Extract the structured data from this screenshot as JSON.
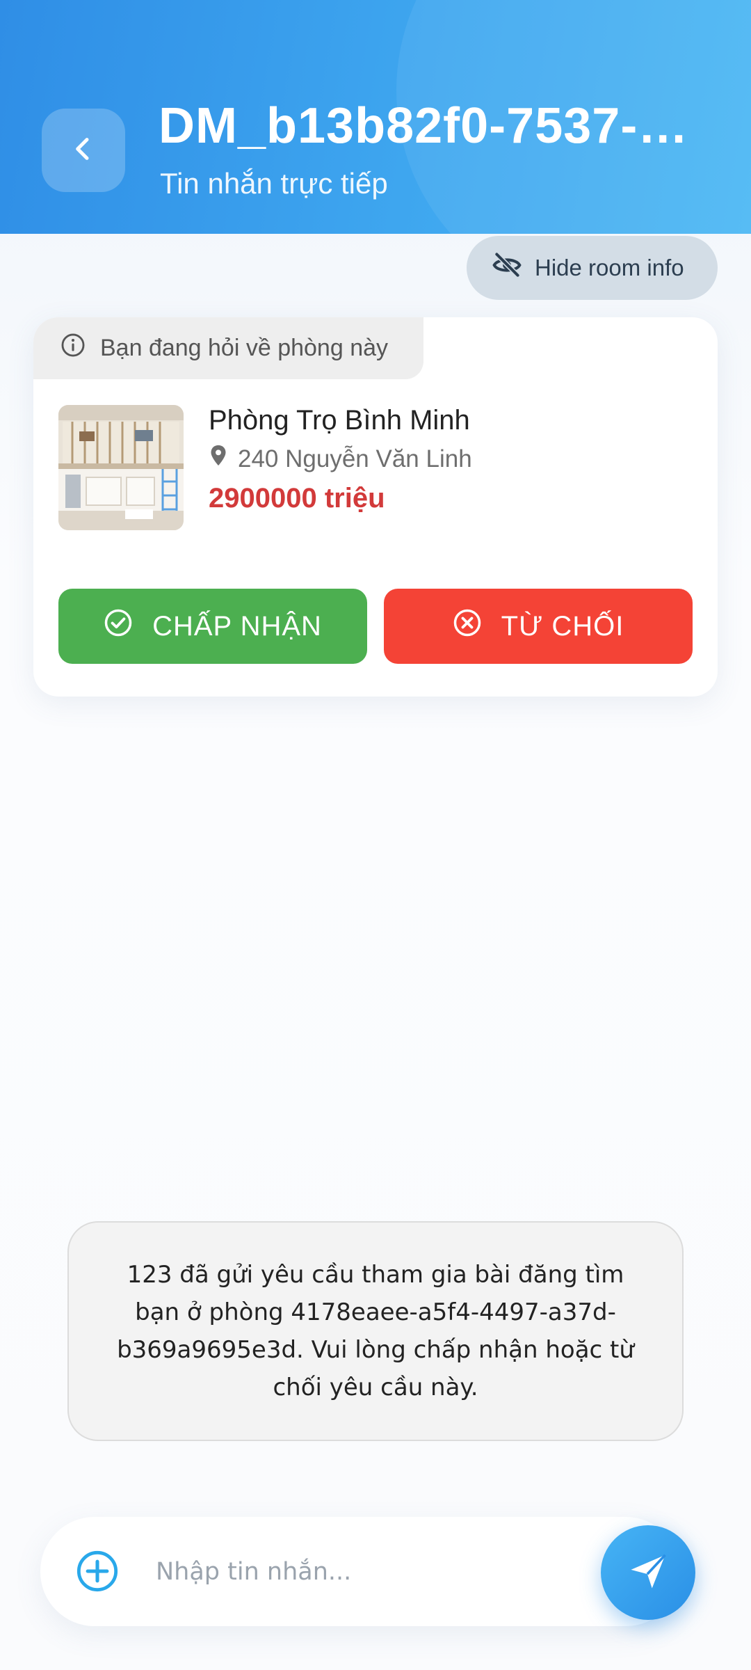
{
  "header": {
    "title": "DM_b13b82f0-7537-4…",
    "subtitle": "Tin nhắn trực tiếp"
  },
  "room_info_toggle": {
    "label": "Hide room info"
  },
  "room_card": {
    "asking_label": "Bạn đang hỏi về phòng này",
    "room_name": "Phòng Trọ Bình Minh",
    "address": "240 Nguyễn Văn Linh",
    "price": "2900000 triệu",
    "accept_label": "CHẤP NHẬN",
    "reject_label": "TỪ CHỐI"
  },
  "messages": [
    {
      "type": "system",
      "text": "123 đã gửi yêu cầu tham gia bài đăng tìm bạn ở phòng 4178eaee-a5f4-4497-a37d-b369a9695e3d. Vui lòng chấp nhận hoặc từ chối yêu cầu này."
    }
  ],
  "composer": {
    "placeholder": "Nhập tin nhắn...",
    "value": ""
  },
  "colors": {
    "header_start": "#2f8ee6",
    "header_end": "#4bb7f4",
    "accept": "#4caf50",
    "reject": "#f44336",
    "price": "#d23a3a",
    "send": "#2a8fe6"
  },
  "icons": {
    "back": "chevron-left-icon",
    "hide": "eye-off-icon",
    "info": "info-icon",
    "location": "location-pin-icon",
    "accept": "check-circle-icon",
    "reject": "x-circle-icon",
    "add": "plus-circle-icon",
    "send": "send-icon"
  }
}
